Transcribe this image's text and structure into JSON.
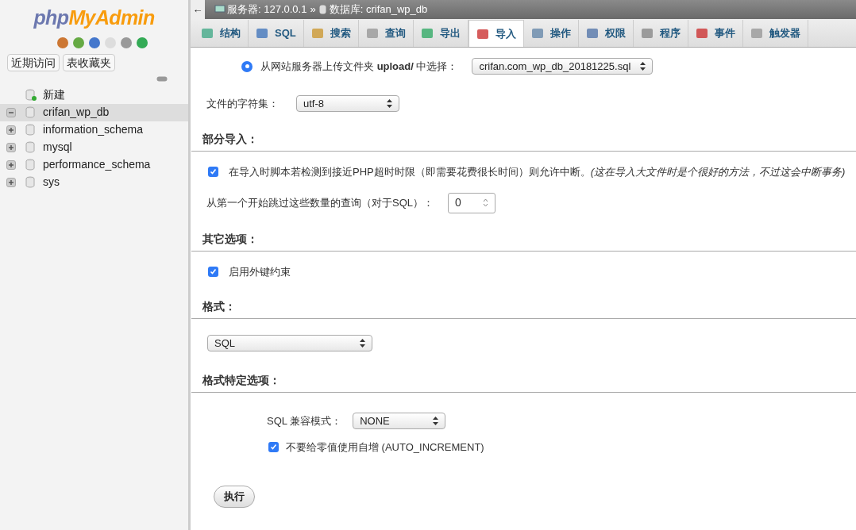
{
  "sidebar": {
    "logo": {
      "php": "php",
      "rest": "MyAdmin"
    },
    "buttons": [
      "近期访问",
      "表收藏夹"
    ],
    "tree": [
      {
        "label": "新建",
        "kind": "new",
        "selected": false
      },
      {
        "label": "crifan_wp_db",
        "kind": "db",
        "expanded": true,
        "selected": true
      },
      {
        "label": "information_schema",
        "kind": "db",
        "expanded": false,
        "selected": false
      },
      {
        "label": "mysql",
        "kind": "db",
        "expanded": false,
        "selected": false
      },
      {
        "label": "performance_schema",
        "kind": "db",
        "expanded": false,
        "selected": false
      },
      {
        "label": "sys",
        "kind": "db",
        "expanded": false,
        "selected": false
      }
    ]
  },
  "breadcrumb": {
    "back": "←",
    "server": "服务器: 127.0.0.1",
    "sep": "»",
    "database": "数据库: crifan_wp_db"
  },
  "tabs": [
    {
      "label": "结构",
      "selected": false
    },
    {
      "label": "SQL",
      "selected": false
    },
    {
      "label": "搜索",
      "selected": false
    },
    {
      "label": "查询",
      "selected": false
    },
    {
      "label": "导出",
      "selected": false
    },
    {
      "label": "导入",
      "selected": true
    },
    {
      "label": "操作",
      "selected": false
    },
    {
      "label": "权限",
      "selected": false
    },
    {
      "label": "程序",
      "selected": false
    },
    {
      "label": "事件",
      "selected": false
    },
    {
      "label": "触发器",
      "selected": false
    }
  ],
  "upload": {
    "label": "从网站服务器上传文件夹 **upload/** 中选择：",
    "selected": true,
    "file": "crifan.com_wp_db_20181225.sql"
  },
  "charset": {
    "label": "文件的字符集：",
    "value": "utf-8"
  },
  "partial": {
    "title": "部分导入：",
    "allow_interrupt": {
      "checked": true,
      "label": "在导入时脚本若检测到接近PHP超时时限（即需要花费很长时间）则允许中断。",
      "note": "(这在导入大文件时是个很好的方法，不过这会中断事务)"
    },
    "skip_label": "从第一个开始跳过这些数量的查询（对于SQL）：",
    "skip_value": "0"
  },
  "other": {
    "title": "其它选项：",
    "foreign_keys": {
      "checked": true,
      "label": "启用外键约束"
    }
  },
  "format": {
    "title": "格式：",
    "value": "SQL"
  },
  "format_options": {
    "title": "格式特定选项：",
    "compat_label": "SQL 兼容模式：",
    "compat_value": "NONE",
    "no_auto_zero": {
      "checked": true,
      "label": "不要给零值使用自增 (AUTO_INCREMENT)"
    }
  },
  "submit": "执行"
}
